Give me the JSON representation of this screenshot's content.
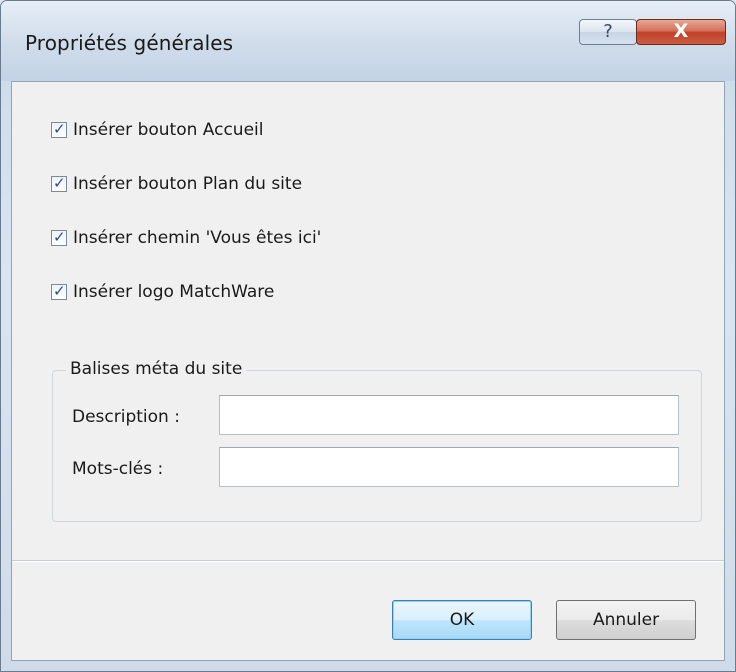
{
  "dialog": {
    "title": "Propriétés générales",
    "help_glyph": "?",
    "close_glyph": "X"
  },
  "options": [
    {
      "label": "Insérer bouton Accueil",
      "checked": true
    },
    {
      "label": "Insérer bouton Plan du site",
      "checked": true
    },
    {
      "label": "Insérer chemin 'Vous êtes ici'",
      "checked": true
    },
    {
      "label": "Insérer logo MatchWare",
      "checked": true
    }
  ],
  "check_glyph": "✓",
  "meta_group": {
    "title": "Balises méta du site",
    "description_label": "Description :",
    "description_value": "",
    "keywords_label": "Mots-clés :",
    "keywords_value": ""
  },
  "buttons": {
    "ok": "OK",
    "cancel": "Annuler"
  },
  "colors": {
    "ok_border": "#3c7fb1",
    "close_red": "#c0412a",
    "check_blue": "#2e4c8c"
  }
}
